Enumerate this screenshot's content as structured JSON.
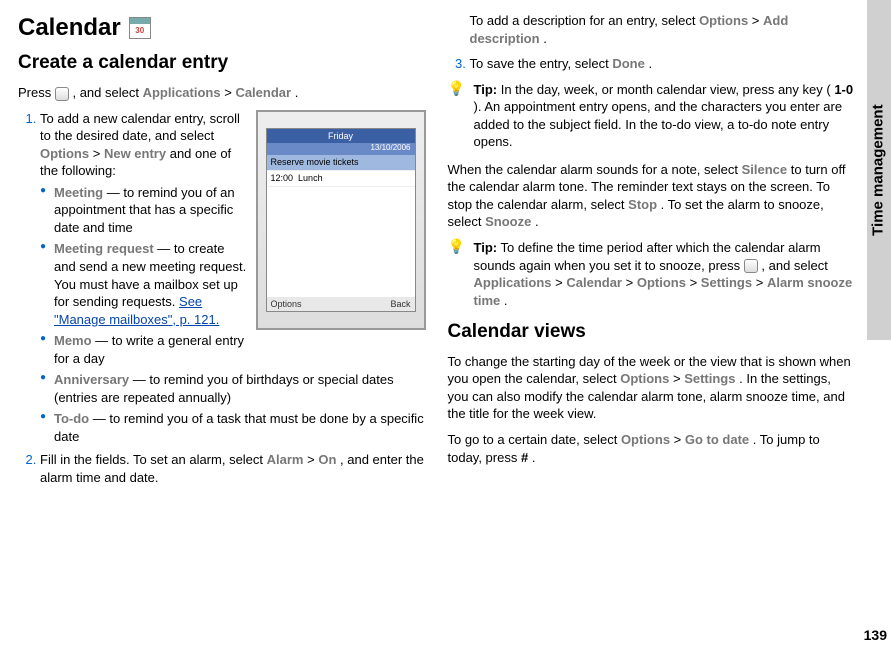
{
  "sideTab": "Time management",
  "pageNumber": "139",
  "col1": {
    "h1": "Calendar",
    "h2a": "Create a calendar entry",
    "intro_pre": "Press ",
    "intro_post": ", and select ",
    "apps": "Applications",
    "gt": " > ",
    "calendar": "Calendar",
    "period": ".",
    "step1_pre": "To add a new calendar entry, scroll to the desired date, and select ",
    "options": "Options",
    "step1_mid": " > ",
    "newentry": "New entry",
    "step1_post": " and one of the following:",
    "b1_key": "Meeting",
    "b1_txt": "  — to remind you of an appointment that has a specific date and time",
    "b2_key": "Meeting request",
    "b2_txt": " — to create and send a new meeting request. You must have a mailbox set up for sending requests. ",
    "b2_link": "See \"Manage mailboxes\", p. 121.",
    "b3_key": "Memo",
    "b3_txt": " — to write a general entry for a day",
    "b4_key": "Anniversary",
    "b4_txt": " — to remind you of birthdays or special dates (entries are repeated annually)",
    "b5_key": "To-do",
    "b5_txt": " — to remind you of a task that must be done by a specific date",
    "step2_pre": "Fill in the fields. To set an alarm, select ",
    "alarm": "Alarm",
    "on": "On",
    "step2_post": ", and enter the alarm time and date.",
    "phone_day": "Friday",
    "phone_date": "13/10/2006",
    "phone_row1": "Reserve movie tickets",
    "phone_time": "12:00",
    "phone_row2": "Lunch",
    "phone_opt": "Options",
    "phone_back": "Back"
  },
  "col2": {
    "addDesc_pre": "To add a description for an entry, select ",
    "options": "Options",
    "gt": " > ",
    "addDesc": "Add description",
    "period": ".",
    "step3_pre": "To save the entry, select ",
    "done": "Done",
    "tip1_label": "Tip:",
    "tip1_txt_a": " In the day, week, or month calendar view, press any key (",
    "tip1_keys": "1-0",
    "tip1_txt_b": "). An appointment entry opens, and the characters you enter are added to the subject field. In the to-do view, a to-do note entry opens.",
    "para_alarm_a": "When the calendar alarm sounds for a note, select ",
    "silence": "Silence",
    "para_alarm_b": " to turn off the calendar alarm tone. The reminder text stays on the screen. To stop the calendar alarm, select ",
    "stop": "Stop",
    "para_alarm_c": ". To set the alarm to snooze, select ",
    "snooze": "Snooze",
    "tip2_label": "Tip:",
    "tip2_txt_a": " To define the time period after which the calendar alarm sounds again when you set it to snooze, press ",
    "tip2_txt_b": ", and select ",
    "apps": "Applications",
    "calendar": "Calendar",
    "opts": "Options",
    "settings": "Settings",
    "alarmSnooze": "Alarm snooze time",
    "h2b": "Calendar views",
    "views_a": "To change the starting day of the week or the view that is shown when you open the calendar, select ",
    "views_b": ". In the settings, you can also modify the calendar alarm tone, alarm snooze time, and the title for the week view.",
    "goto_a": "To go to a certain date, select ",
    "gotodate": "Go to date",
    "goto_b": ". To jump to today, press ",
    "hash": "#",
    "goto_c": "."
  }
}
